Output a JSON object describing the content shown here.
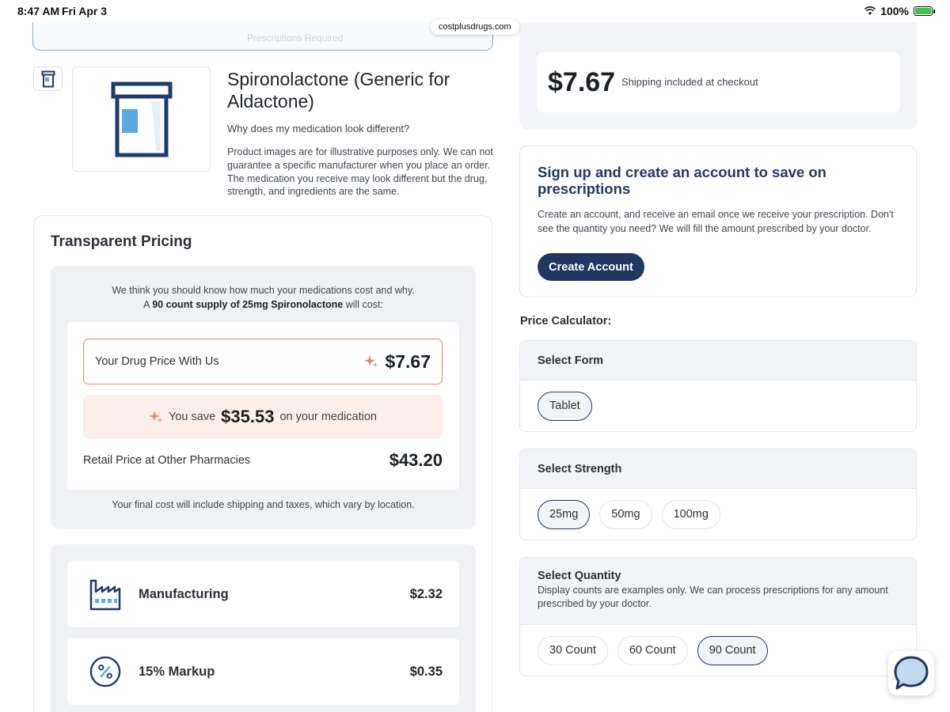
{
  "status_bar": {
    "time": "8:47 AM",
    "date": "Fri Apr 3",
    "battery": "100%",
    "url": "costplusdrugs.com"
  },
  "top": {
    "search_placeholder": "Prescriptions Required"
  },
  "summary": {
    "price": "$7.67",
    "shipping_note": "Shipping included at checkout"
  },
  "product": {
    "title": "Spironolactone (Generic for Aldactone)",
    "why_link": "Why does my medication look different?",
    "disclaimer": "Product images are for illustrative purposes only. We can not guarantee a specific manufacturer when you place an order. The medication you receive may look different but the drug, strength, and ingredients are the same."
  },
  "pricing": {
    "title": "Transparent Pricing",
    "intro_line1": "We think you should know how much your medications cost and why.",
    "intro_prefix": "A",
    "intro_bold": "90 count supply of 25mg Spironolactone",
    "intro_suffix": "will cost:",
    "our_price_label": "Your Drug Price With Us",
    "our_price": "$7.67",
    "save_prefix": "You save",
    "save_amount": "$35.53",
    "save_suffix": "on your medication",
    "retail_label": "Retail Price at Other Pharmacies",
    "retail_price": "$43.20",
    "footnote": "Your final cost will include shipping and taxes, which vary by location.",
    "breakdown": [
      {
        "label": "Manufacturing",
        "value": "$2.32",
        "icon": "factory-icon"
      },
      {
        "label": "15% Markup",
        "value": "$0.35",
        "icon": "percent-icon"
      }
    ]
  },
  "signup": {
    "title": "Sign up and create an account to save on prescriptions",
    "description": "Create an account, and receive an email once we receive your prescription. Don't see the quantity you need? We will fill the amount prescribed by your doctor.",
    "button": "Create Account"
  },
  "calculator": {
    "label": "Price Calculator:",
    "form": {
      "title": "Select Form",
      "options": [
        "Tablet"
      ],
      "selected": "Tablet"
    },
    "strength": {
      "title": "Select Strength",
      "options": [
        "25mg",
        "50mg",
        "100mg"
      ],
      "selected": "25mg"
    },
    "quantity": {
      "title": "Select Quantity",
      "note": "Display counts are examples only. We can process prescriptions for any amount prescribed by your doctor.",
      "options": [
        "30 Count",
        "60 Count",
        "90 Count"
      ],
      "selected": "90 Count"
    }
  },
  "colors": {
    "navy": "#1f3761",
    "accent_orange": "#e48a66",
    "save_bg": "#fcefe9",
    "panel_gray": "#eff1f5",
    "bottle_blue": "#1f3a6b",
    "label_blue": "#5aa9e0"
  }
}
